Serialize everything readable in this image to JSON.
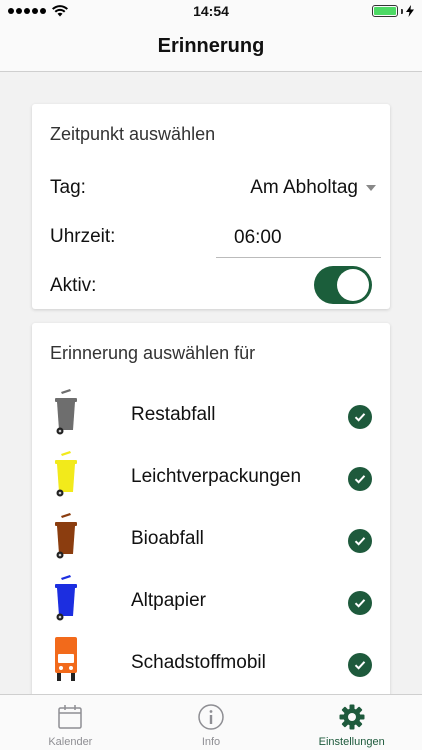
{
  "status_bar": {
    "time": "14:54"
  },
  "nav": {
    "title": "Erinnerung"
  },
  "time_card": {
    "title": "Zeitpunkt auswählen",
    "day_label": "Tag:",
    "day_value": "Am Abholtag",
    "time_label": "Uhrzeit:",
    "time_value": "06:00",
    "active_label": "Aktiv:",
    "active_on": true
  },
  "waste_card": {
    "title": "Erinnerung auswählen für",
    "items": [
      {
        "label": "Restabfall",
        "icon": "grey-bin-icon",
        "color": "#6e6e6e",
        "checked": true
      },
      {
        "label": "Leichtverpackungen",
        "icon": "yellow-bin-icon",
        "color": "#f2ea1b",
        "checked": true
      },
      {
        "label": "Bioabfall",
        "icon": "brown-bin-icon",
        "color": "#8b3d0f",
        "checked": true
      },
      {
        "label": "Altpapier",
        "icon": "blue-bin-icon",
        "color": "#1c2ee0",
        "checked": true
      },
      {
        "label": "Schadstoffmobil",
        "icon": "orange-truck-icon",
        "color": "#f26a1b",
        "checked": true
      }
    ]
  },
  "tabs": [
    {
      "label": "Kalender",
      "icon": "calendar-icon",
      "active": false
    },
    {
      "label": "Info",
      "icon": "info-icon",
      "active": false
    },
    {
      "label": "Einstellungen",
      "icon": "gear-icon",
      "active": true
    }
  ],
  "colors": {
    "accent": "#1e5a3c",
    "toggle": "#1b5e3b"
  }
}
